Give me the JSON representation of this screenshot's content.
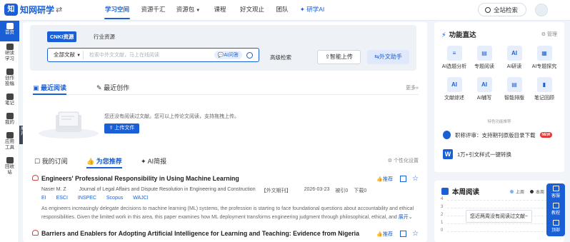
{
  "app": {
    "logo_mark": "知",
    "logo_text": "知网研学",
    "swap_icon": "⇄"
  },
  "nav": {
    "items": [
      "学习空间",
      "资源千汇",
      "资源包",
      "课程",
      "好文观止",
      "团队",
      "研学AI"
    ],
    "active_index": 0,
    "search_label": "全站检索"
  },
  "leftnav": {
    "items": [
      "首页",
      "研读学习",
      "创作投稿",
      "笔记",
      "我的",
      "应用工具",
      "回收站"
    ],
    "expand_label": "展开"
  },
  "search": {
    "tabs": [
      "CNKI资源",
      "行业资源"
    ],
    "scope": "全部文献",
    "placeholder": "检索中外文文献，马上在线阅读",
    "ai_label": "AI问答",
    "advanced": "高级检索",
    "upload_button": "智能上传",
    "helper_button": "外文助手"
  },
  "reading": {
    "tabs": [
      "最近阅读",
      "最近创作"
    ],
    "more": "更多»",
    "empty_text": "您还没有阅读过文献。您可以上传论文阅读，支持拖拽上传。",
    "upload_button": "上传文件"
  },
  "recommend": {
    "tabs": [
      "我的订阅",
      "为您推荐",
      "AI简报"
    ],
    "settings": "个性化设置",
    "articles": [
      {
        "title": "Engineers' Professional Responsibility in Using Machine Learning",
        "author": "Naser M. Z",
        "journal": "Journal of Legal Affairs and Dispute Resolution in Engineering and Construction",
        "type": "【外文期刊】",
        "date": "2026-03-23",
        "cited": "被引0",
        "downloads": "下载0",
        "tags": [
          "EI",
          "ESCI",
          "INSPEC",
          "Scopus",
          "WAJCI"
        ],
        "abstract": "As engineers increasingly delegate decisions to machine learning (ML) systems, the profession is starting to face foundational questions about accountability and ethical responsibilities. Given the limited work in this area, this paper examines how ML deployment transforms engineering judgment through philosophical, ethical, and",
        "expand": "展开",
        "recommend": "推荐"
      },
      {
        "title": "Barriers and Enablers for Adopting Artificial Intelligence for Learning and Teaching: Evidence from Nigeria",
        "recommend": "推荐"
      }
    ]
  },
  "functions": {
    "title": "功能直达",
    "manage": "管理",
    "items": [
      {
        "label": "AI选题分析",
        "icon": "≡"
      },
      {
        "label": "专题阅读",
        "icon": "▤"
      },
      {
        "label": "AI研读",
        "icon": "AI"
      },
      {
        "label": "AI专题探究",
        "icon": "▦"
      },
      {
        "label": "文献综述",
        "icon": "AI"
      },
      {
        "label": "AI辅写",
        "icon": "AI"
      },
      {
        "label": "智能排版",
        "icon": "▤"
      },
      {
        "label": "笔记回顾",
        "icon": "▮"
      }
    ],
    "promo_label": "特色功能推荐",
    "promo1": "职称评审：支持期刊原版目录下载",
    "promo1_badge": "NEW",
    "promo2": "1万+引文样式一键转换",
    "promo2_icon": "W"
  },
  "weekly": {
    "title": "本周阅读",
    "legend": [
      "上周",
      "本周"
    ],
    "y_ticks": [
      "4",
      "3",
      "2",
      "1",
      "0"
    ],
    "tooltip": "您近两周没有阅读过文献~",
    "colors": {
      "last_week": "#7fb0f5",
      "this_week": "#333333"
    }
  },
  "floatbar": {
    "items": [
      "客服",
      "教程",
      "顶部"
    ]
  }
}
